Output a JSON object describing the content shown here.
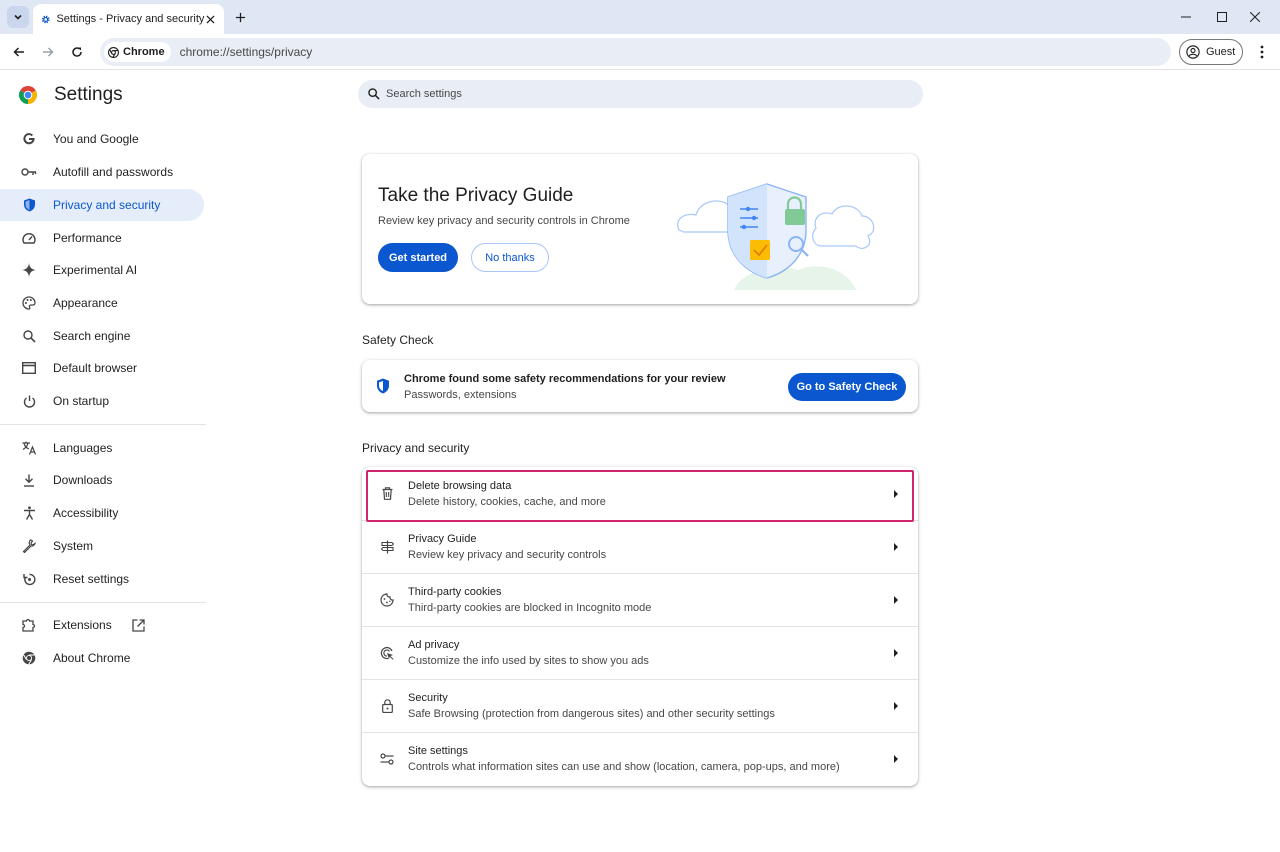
{
  "tab": {
    "title": "Settings - Privacy and security"
  },
  "omnibox": {
    "chip_label": "Chrome",
    "url": "chrome://settings/privacy"
  },
  "profile": {
    "label": "Guest"
  },
  "sidebar": {
    "title": "Settings",
    "items": [
      {
        "label": "You and Google",
        "icon": "google-g-icon"
      },
      {
        "label": "Autofill and passwords",
        "icon": "key-icon"
      },
      {
        "label": "Privacy and security",
        "icon": "shield-icon",
        "active": true
      },
      {
        "label": "Performance",
        "icon": "speedometer-icon"
      },
      {
        "label": "Experimental AI",
        "icon": "sparkle-icon"
      },
      {
        "label": "Appearance",
        "icon": "palette-icon"
      },
      {
        "label": "Search engine",
        "icon": "search-icon"
      },
      {
        "label": "Default browser",
        "icon": "browser-window-icon"
      },
      {
        "label": "On startup",
        "icon": "power-icon"
      },
      {
        "label": "Languages",
        "icon": "translate-icon"
      },
      {
        "label": "Downloads",
        "icon": "download-icon"
      },
      {
        "label": "Accessibility",
        "icon": "accessibility-icon"
      },
      {
        "label": "System",
        "icon": "wrench-icon"
      },
      {
        "label": "Reset settings",
        "icon": "reset-icon"
      },
      {
        "label": "Extensions",
        "icon": "puzzle-icon"
      },
      {
        "label": "About Chrome",
        "icon": "chrome-icon"
      }
    ]
  },
  "search": {
    "placeholder": "Search settings"
  },
  "privacy_guide": {
    "title": "Take the Privacy Guide",
    "subtitle": "Review key privacy and security controls in Chrome",
    "primary_button": "Get started",
    "secondary_button": "No thanks"
  },
  "safety_check": {
    "section_title": "Safety Check",
    "title": "Chrome found some safety recommendations for your review",
    "subtitle": "Passwords, extensions",
    "button": "Go to Safety Check"
  },
  "privacy_security": {
    "section_title": "Privacy and security",
    "rows": [
      {
        "title": "Delete browsing data",
        "subtitle": "Delete history, cookies, cache, and more",
        "icon": "trash-icon"
      },
      {
        "title": "Privacy Guide",
        "subtitle": "Review key privacy and security controls",
        "icon": "signpost-icon"
      },
      {
        "title": "Third-party cookies",
        "subtitle": "Third-party cookies are blocked in Incognito mode",
        "icon": "cookie-icon"
      },
      {
        "title": "Ad privacy",
        "subtitle": "Customize the info used by sites to show you ads",
        "icon": "ad-target-icon"
      },
      {
        "title": "Security",
        "subtitle": "Safe Browsing (protection from dangerous sites) and other security settings",
        "icon": "lock-icon"
      },
      {
        "title": "Site settings",
        "subtitle": "Controls what information sites can use and show (location, camera, pop-ups, and more)",
        "icon": "tune-icon"
      }
    ]
  },
  "colors": {
    "accent": "#0b57d0",
    "active_nav_bg": "#e5edfa",
    "highlight_border": "#d0246e",
    "titlebar_bg": "#dfe7f5"
  }
}
